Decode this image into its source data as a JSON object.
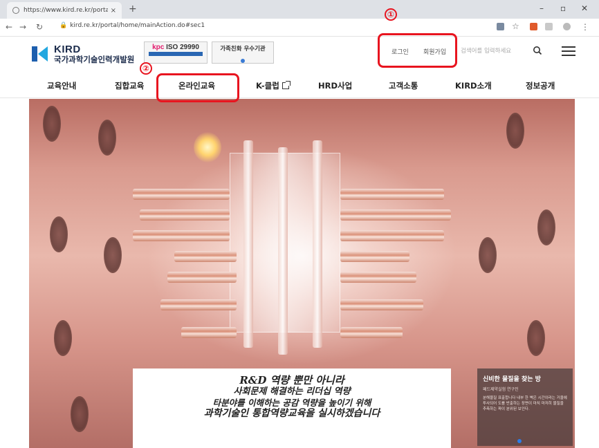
{
  "browser": {
    "tab_title": "https://www.kird.re.kr/portal/h",
    "url": "kird.re.kr/portal/home/mainAction.do#sec1"
  },
  "header": {
    "logo_en": "KIRD",
    "logo_ko": "국가과학기술인력개발원",
    "badge_iso": "ISO 29990",
    "badge_kpc": "kpc",
    "badge_family": "가족친화 우수기관",
    "login": "로그인",
    "signup": "회원가입",
    "search_placeholder": "검색어를 입력하세요"
  },
  "annotations": {
    "num1": "①",
    "num2": "②"
  },
  "gnb": [
    {
      "label": "교육안내"
    },
    {
      "label": "집합교육"
    },
    {
      "label": "온라인교육"
    },
    {
      "label": "K-클럽"
    },
    {
      "label": "HRD사업"
    },
    {
      "label": "고객소통"
    },
    {
      "label": "KIRD소개"
    },
    {
      "label": "정보공개"
    }
  ],
  "hero": {
    "slogan_line1": "R&D 역량 뿐만 아니라",
    "slogan_line2": "사회문제 해결하는 리더십 역량",
    "slogan_line3": "타분야를 이해하는 공감 역량을 높이기 위해",
    "slogan_line4": "과학기술인 통합역량교육을 실시하겠습니다",
    "panel_title": "신비한 물질을 찾는 방",
    "panel_sub": "페드제약실험 연구인",
    "panel_body": "분해물질 표출합니다 내부 한 벽은 시간이라는 거울에 투사되어 도를 반출하는 장면이 마치 마저히 물질을 추측하는 파이 분위된 보인다."
  },
  "colors": {
    "callout": "#e8141f",
    "brand_blue": "#1d5fae"
  }
}
